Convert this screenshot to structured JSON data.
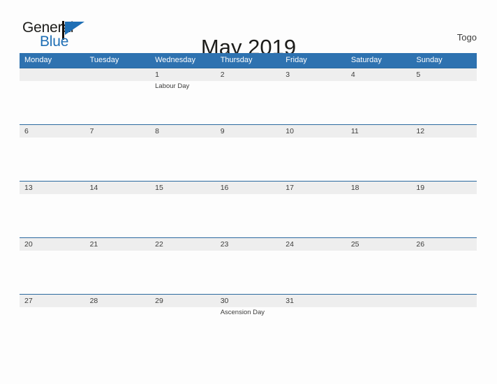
{
  "header": {
    "logo": {
      "text_primary": "General",
      "text_secondary": "Blue",
      "mark_icon": "triangle-flag-icon"
    },
    "title": "May 2019",
    "country": "Togo"
  },
  "colors": {
    "header_blue": "#2e72b0",
    "row_divider_blue": "#2b699f",
    "day_band_gray": "#eeeeee",
    "logo_blue": "#1f6fb5",
    "text_dark": "#3c3c3b",
    "page_background": "#fdfdfd"
  },
  "calendar": {
    "weekdays": [
      "Monday",
      "Tuesday",
      "Wednesday",
      "Thursday",
      "Friday",
      "Saturday",
      "Sunday"
    ],
    "weeks": [
      [
        {
          "date": "",
          "event": ""
        },
        {
          "date": "",
          "event": ""
        },
        {
          "date": "1",
          "event": "Labour Day"
        },
        {
          "date": "2",
          "event": ""
        },
        {
          "date": "3",
          "event": ""
        },
        {
          "date": "4",
          "event": ""
        },
        {
          "date": "5",
          "event": ""
        }
      ],
      [
        {
          "date": "6",
          "event": ""
        },
        {
          "date": "7",
          "event": ""
        },
        {
          "date": "8",
          "event": ""
        },
        {
          "date": "9",
          "event": ""
        },
        {
          "date": "10",
          "event": ""
        },
        {
          "date": "11",
          "event": ""
        },
        {
          "date": "12",
          "event": ""
        }
      ],
      [
        {
          "date": "13",
          "event": ""
        },
        {
          "date": "14",
          "event": ""
        },
        {
          "date": "15",
          "event": ""
        },
        {
          "date": "16",
          "event": ""
        },
        {
          "date": "17",
          "event": ""
        },
        {
          "date": "18",
          "event": ""
        },
        {
          "date": "19",
          "event": ""
        }
      ],
      [
        {
          "date": "20",
          "event": ""
        },
        {
          "date": "21",
          "event": ""
        },
        {
          "date": "22",
          "event": ""
        },
        {
          "date": "23",
          "event": ""
        },
        {
          "date": "24",
          "event": ""
        },
        {
          "date": "25",
          "event": ""
        },
        {
          "date": "26",
          "event": ""
        }
      ],
      [
        {
          "date": "27",
          "event": ""
        },
        {
          "date": "28",
          "event": ""
        },
        {
          "date": "29",
          "event": ""
        },
        {
          "date": "30",
          "event": "Ascension Day"
        },
        {
          "date": "31",
          "event": ""
        },
        {
          "date": "",
          "event": ""
        },
        {
          "date": "",
          "event": ""
        }
      ]
    ]
  }
}
